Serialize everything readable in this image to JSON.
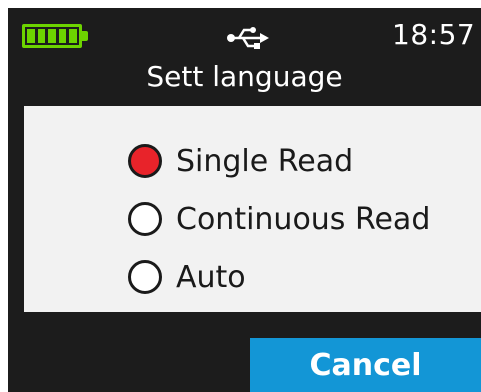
{
  "status_bar": {
    "battery_icon": "battery-full-icon",
    "battery_color": "#6dd400",
    "battery_level": 1.0,
    "usb_icon": "usb-icon",
    "time": "18:57"
  },
  "title": "Sett language",
  "options": [
    {
      "label": "Single Read",
      "selected": true
    },
    {
      "label": "Continuous Read",
      "selected": false
    },
    {
      "label": "Auto",
      "selected": false
    }
  ],
  "cancel_label": "Cancel",
  "colors": {
    "background": "#1c1c1c",
    "panel": "#f2f2f2",
    "selected_radio": "#e8232a",
    "button": "#1396d6"
  }
}
